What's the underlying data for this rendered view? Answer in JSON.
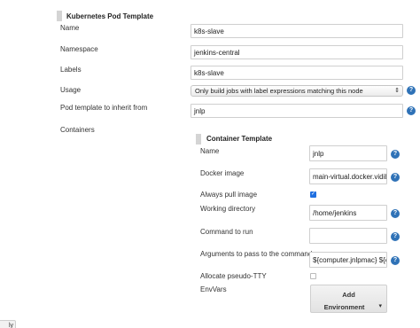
{
  "pod_template": {
    "title": "Kubernetes Pod Template",
    "fields": {
      "name": {
        "label": "Name",
        "value": "k8s-slave"
      },
      "namespace": {
        "label": "Namespace",
        "value": "jenkins-central"
      },
      "labels": {
        "label": "Labels",
        "value": "k8s-slave"
      },
      "usage": {
        "label": "Usage",
        "selected": "Only build jobs with label expressions matching this node"
      },
      "inherit": {
        "label": "Pod template to inherit from",
        "value": "jnlp"
      }
    },
    "containers_label": "Containers"
  },
  "container_template": {
    "title": "Container Template",
    "fields": {
      "name": {
        "label": "Name",
        "value": "jnlp"
      },
      "docker_image": {
        "label": "Docker image",
        "value": "main-virtual.docker.vidib"
      },
      "always_pull": {
        "label": "Always pull image",
        "checked": true
      },
      "working_dir": {
        "label": "Working directory",
        "value": "/home/jenkins"
      },
      "command": {
        "label": "Command to run",
        "value": ""
      },
      "arguments": {
        "label": "Arguments to pass to the command",
        "value": "${computer.jnlpmac} ${c"
      },
      "pseudo_tty": {
        "label": "Allocate pseudo-TTY",
        "checked": false
      },
      "env_vars": {
        "label": "EnvVars"
      }
    },
    "add_button": {
      "line1": "Add",
      "line2": "Environment",
      "caret": "▾"
    }
  },
  "help_icon_glyph": "?",
  "bottom_button_label": "ly",
  "colors": {
    "help": "#2f72b7",
    "checkbox_on": "#1f6fe0"
  }
}
